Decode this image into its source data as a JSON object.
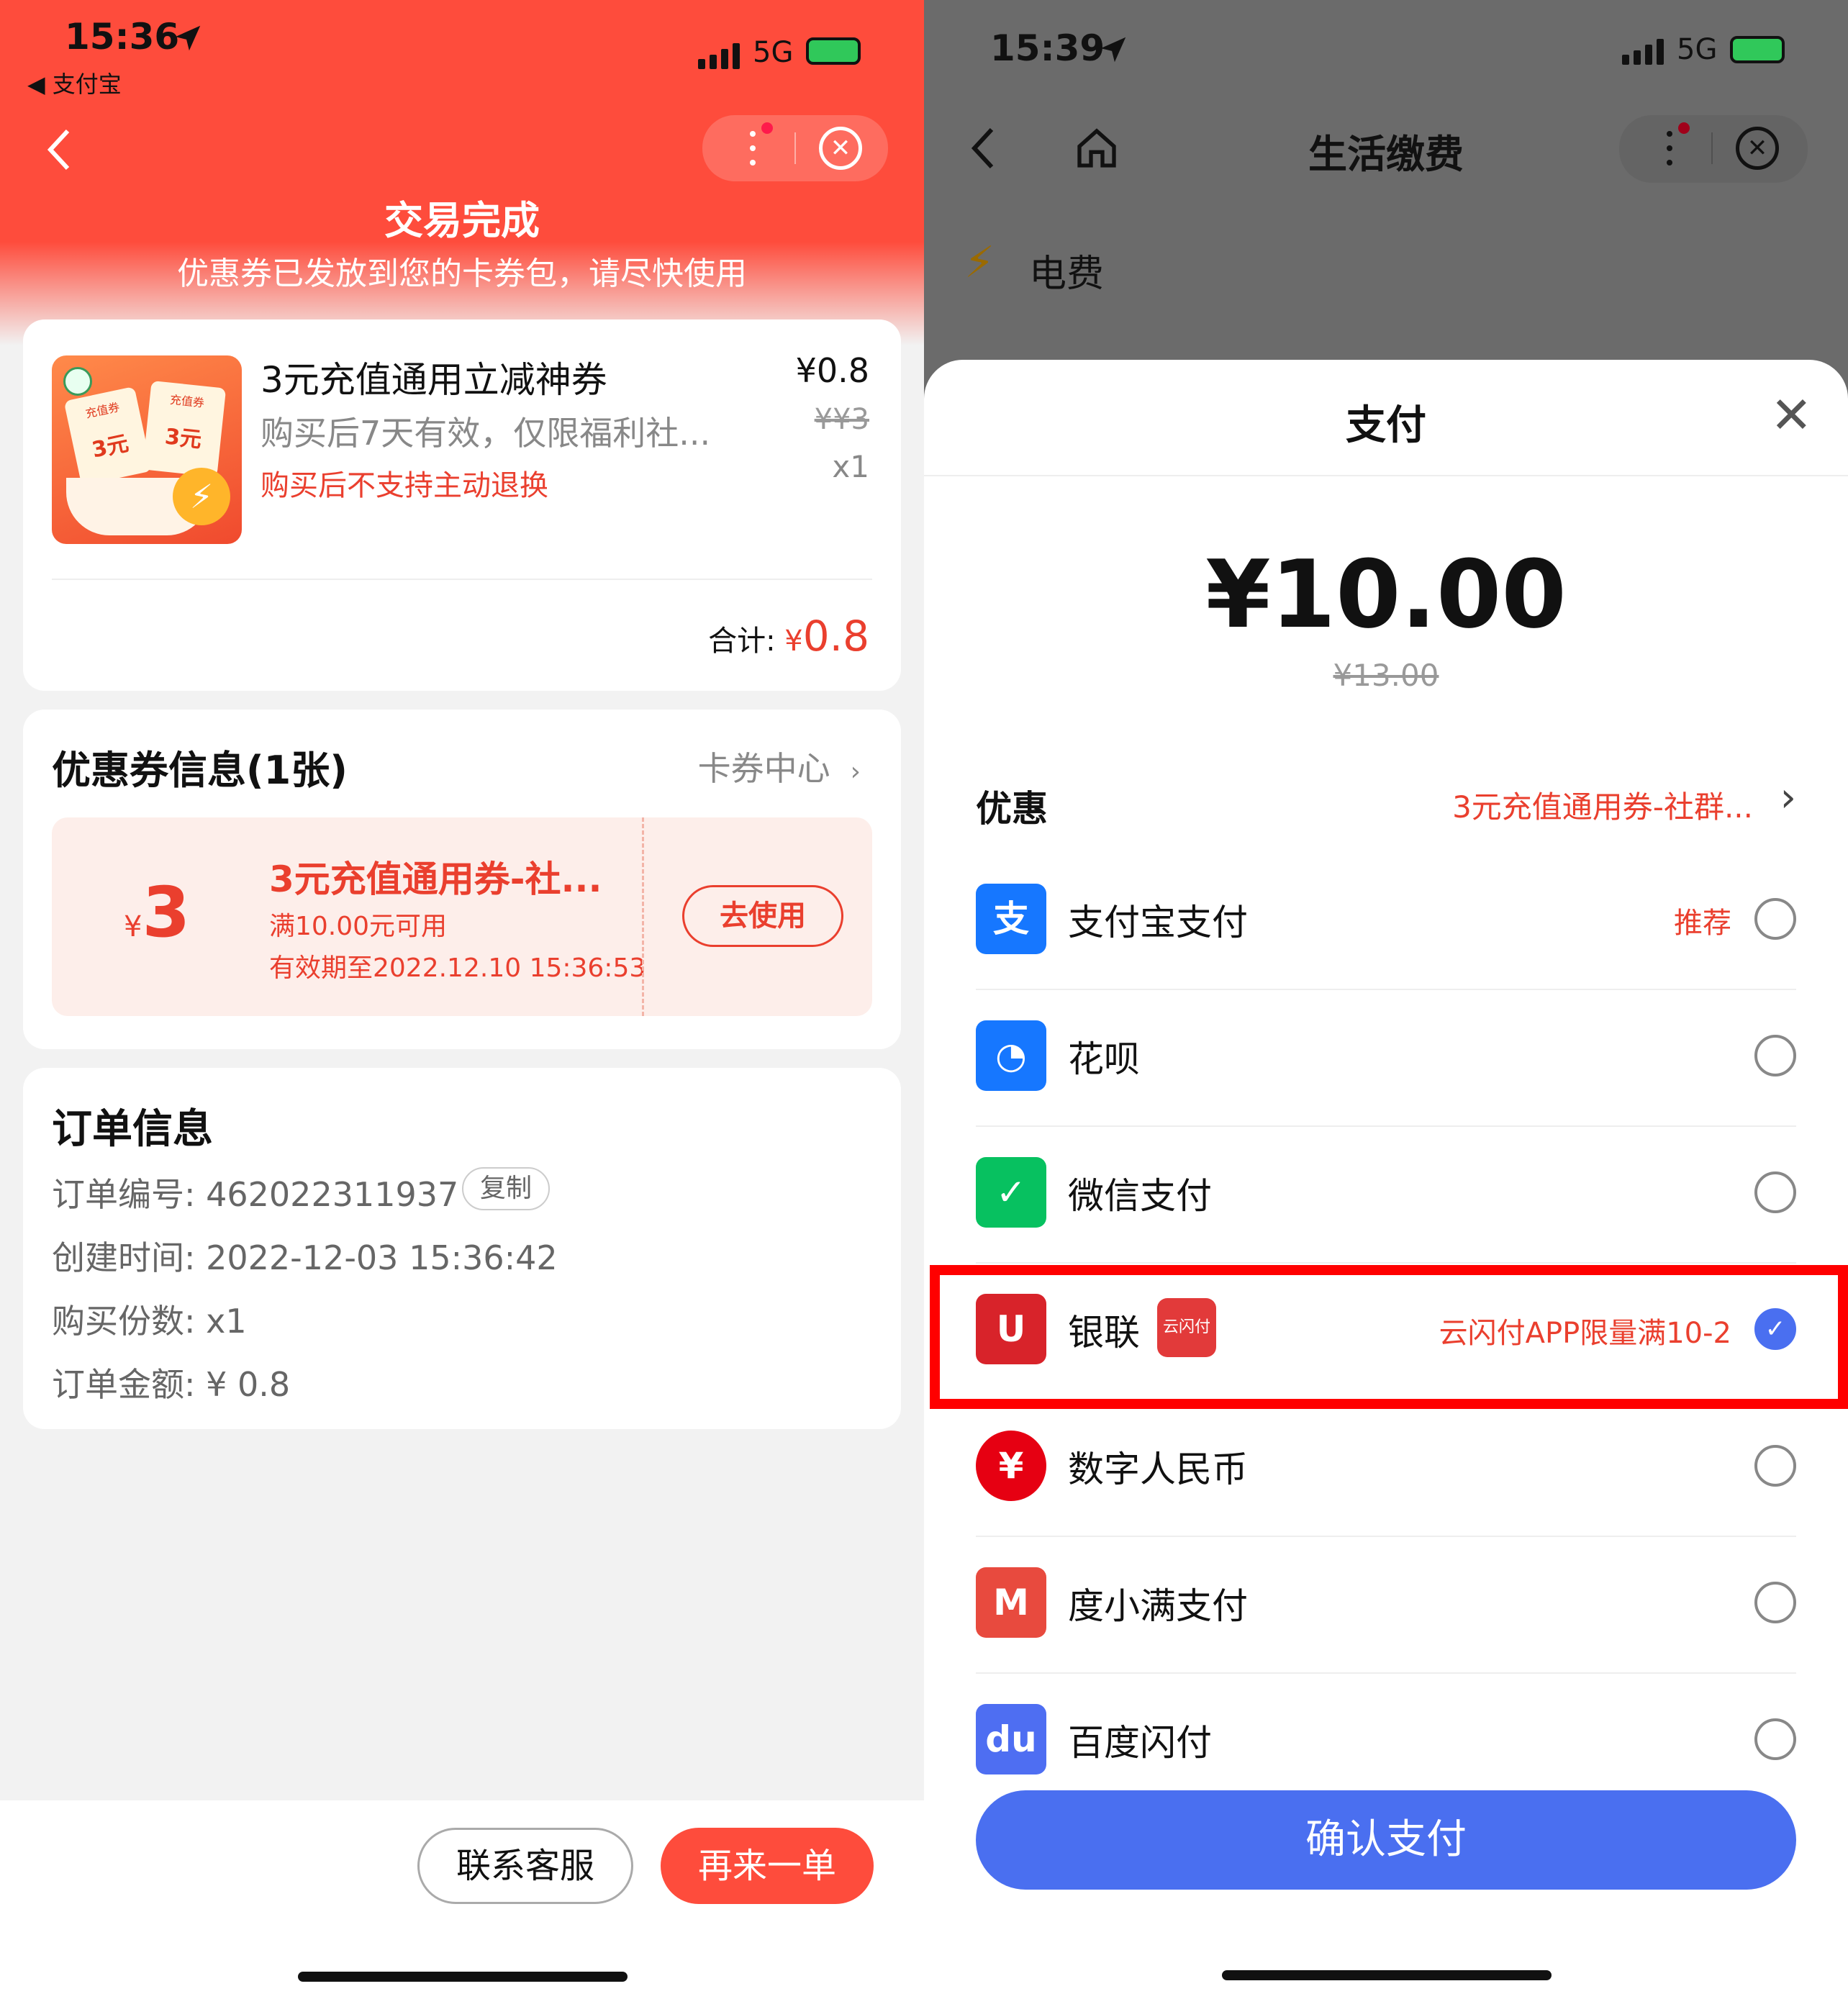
{
  "left": {
    "status": {
      "time": "15:36",
      "back_app": "支付宝",
      "network": "5G"
    },
    "header": {
      "title": "交易完成",
      "subtitle": "优惠券已发放到您的卡券包，请尽快使用"
    },
    "product": {
      "name": "3元充值通用立减神券",
      "desc": "购买后7天有效，仅限福利社...",
      "warning": "购买后不支持主动退换",
      "price": "¥0.8",
      "original_price": "¥¥3",
      "qty": "x1",
      "total_label": "合计:",
      "total_currency": "¥",
      "total_value": "0.8",
      "image_text_1": "充值券",
      "image_text_2": "3元"
    },
    "coupon_info": {
      "title": "优惠券信息(1张)",
      "link": "卡券中心",
      "amount_symbol": "¥",
      "amount": "3",
      "name": "3元充值通用券-社...",
      "condition": "满10.00元可用",
      "expiry": "有效期至2022.12.10 15:36:53",
      "use_button": "去使用"
    },
    "order": {
      "title": "订单信息",
      "number_label": "订单编号: 462022311937",
      "copy_button": "复制",
      "created": "创建时间: 2022-12-03 15:36:42",
      "quantity": "购买份数: x1",
      "amount": "订单金额: ¥ 0.8"
    },
    "footer": {
      "contact_button": "联系客服",
      "reorder_button": "再来一单"
    }
  },
  "right": {
    "status": {
      "time": "15:39",
      "network": "5G"
    },
    "nav": {
      "title": "生活缴费"
    },
    "bg_item": "电费",
    "sheet": {
      "title": "支付",
      "amount": "¥10.00",
      "original": "¥13.00",
      "discount_label": "优惠",
      "discount_value": "3元充值通用券-社群...",
      "methods": [
        {
          "label": "支付宝支付",
          "hint": "推荐",
          "icon": "alipay-icon",
          "color": "#1677ff"
        },
        {
          "label": "花呗",
          "hint": "",
          "icon": "huabei-icon",
          "color": "#1677ff"
        },
        {
          "label": "微信支付",
          "hint": "",
          "icon": "wechat-pay-icon",
          "color": "#07c160"
        },
        {
          "label": "银联",
          "hint": "云闪付APP限量满10-2",
          "icon": "unionpay-icon",
          "color": "#d8232a"
        },
        {
          "label": "数字人民币",
          "hint": "",
          "icon": "digital-rmb-icon",
          "color": "#e60012"
        },
        {
          "label": "度小满支付",
          "hint": "",
          "icon": "duxiaoman-icon",
          "color": "#e84a3e"
        },
        {
          "label": "百度闪付",
          "hint": "",
          "icon": "baidu-pay-icon",
          "color": "#4e6ef2"
        }
      ],
      "unionpay_badge": "云闪付",
      "confirm_button": "确认支付"
    }
  },
  "colors": {
    "brand_red": "#fe4c3c",
    "confirm_blue": "#4a6ff0",
    "highlight_red": "#ff0000"
  }
}
